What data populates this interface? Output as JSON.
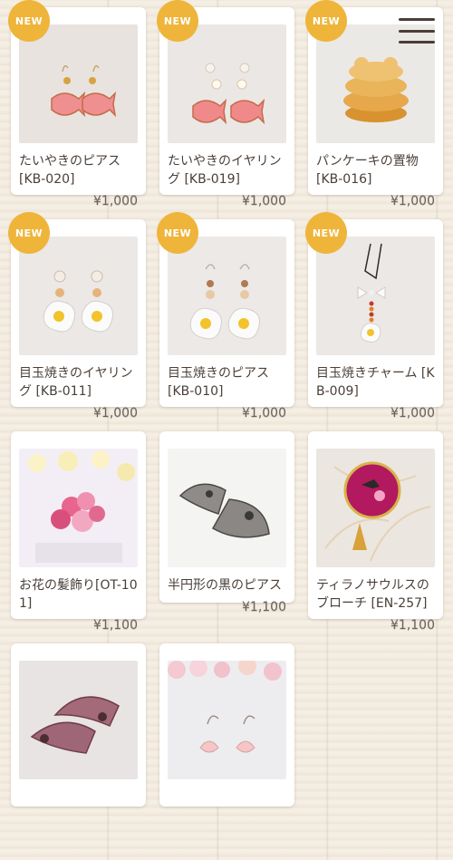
{
  "menu": {
    "icon": "hamburger-menu-icon"
  },
  "products": [
    {
      "title": "たいやきのピアス [KB-020]",
      "price": "¥1,000",
      "badge": "NEW"
    },
    {
      "title": "たいやきのイヤリング [KB-019]",
      "price": "¥1,000",
      "badge": "NEW"
    },
    {
      "title": "パンケーキの置物 [KB-016]",
      "price": "¥1,000",
      "badge": "NEW"
    },
    {
      "title": "目玉焼きのイヤリング [KB-011]",
      "price": "¥1,000",
      "badge": "NEW"
    },
    {
      "title": "目玉焼きのピアス [KB-010]",
      "price": "¥1,000",
      "badge": "NEW"
    },
    {
      "title": "目玉焼きチャーム [KB-009]",
      "price": "¥1,000",
      "badge": "NEW"
    },
    {
      "title": "お花の髪飾り[OT-101]",
      "price": "¥1,100"
    },
    {
      "title": "半円形の黒のピアス",
      "price": "¥1,100"
    },
    {
      "title": "ティラノサウルスのブローチ [EN-257]",
      "price": "¥1,100"
    }
  ],
  "colors": {
    "badge": "#eeb53a",
    "background": "#f1e9dc",
    "card": "#ffffff"
  }
}
